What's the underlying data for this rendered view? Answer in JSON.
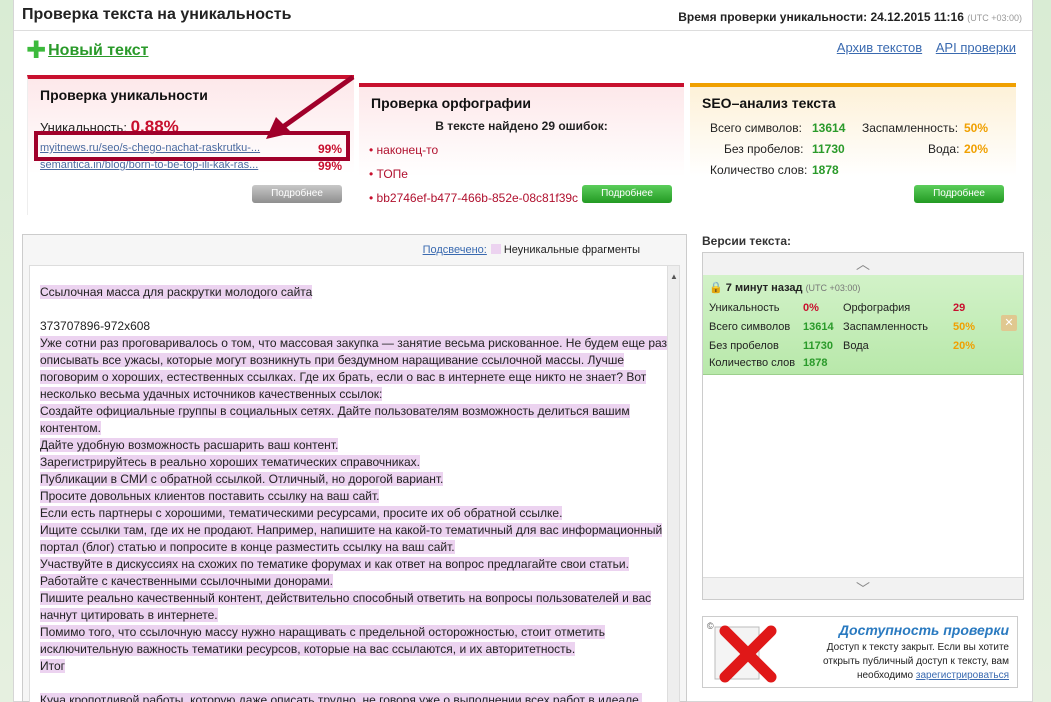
{
  "header": {
    "title": "Проверка текста на уникальность",
    "time_label": "Время проверки уникальности: 24.12.2015 11:16",
    "time_tz": "(UTC +03:00)"
  },
  "new_text": "Новый текст",
  "links": {
    "archive": "Архив текстов",
    "api": "API проверки"
  },
  "uniq_card": {
    "title": "Проверка уникальности",
    "uniq_label": "Уникальность:",
    "uniq_value": "0.88%",
    "sources": [
      {
        "url": "myitnews.ru/seo/s-chego-nachat-raskrutku-...",
        "pct": "99%"
      },
      {
        "url": "semantica.in/blog/born-to-be-top-ili-kak-ras...",
        "pct": "99%"
      }
    ],
    "more": "Подробнее"
  },
  "spell_card": {
    "title": "Проверка орфографии",
    "found": "В тексте найдено 29 ошибок:",
    "errors": [
      "наконец-то",
      "ТОПе",
      "bb2746ef-b477-466b-852e-08c81f39c"
    ],
    "more": "Подробнее"
  },
  "seo_card": {
    "title": "SEO–анализ текста",
    "total_label": "Всего символов:",
    "total": "13614",
    "spam_label": "Заспамленность:",
    "spam": "50%",
    "nospace_label": "Без пробелов:",
    "nospace": "11730",
    "water_label": "Вода:",
    "water": "20%",
    "words_label": "Количество слов:",
    "words": "1878",
    "more": "Подробнее"
  },
  "editor": {
    "highlight_link": "Подсвечено:",
    "legend": "Неуникальные фрагменты",
    "lines": [
      "Ссылочная масса для раскрутки молодого сайта",
      "",
      "373707896-972x608",
      "Уже сотни раз проговаривалось о том, что массовая закупка — занятие весьма рискованное. Не будем еще раз описывать все ужасы, которые могут возникнуть при бездумном наращивание ссылочной массы. Лучше поговорим о хороших, естественных ссылках. Где их брать, если о вас в интернете еще никто не знает? Вот несколько весьма удачных источников качественных ссылок:",
      "Создайте официальные группы в социальных сетях. Дайте пользователям возможность делиться вашим контентом.",
      "Дайте удобную возможность расшарить ваш контент.",
      "Зарегистрируйтесь в реально хороших тематических справочниках.",
      "Публикации в СМИ с обратной ссылкой. Отличный, но дорогой вариант.",
      "Просите довольных клиентов поставить ссылку на ваш сайт.",
      "Если есть партнеры с хорошими, тематическими ресурсами, просите их об обратной ссылке.",
      "Ищите ссылки там, где их не продают. Например, напишите на какой-то тематичный для вас информационный портал (блог) статью и попросите в конце разместить ссылку на ваш сайт.",
      "Участвуйте в дискуссиях на схожих по тематике форумах и как ответ на вопрос предлагайте свои статьи.",
      "Работайте с качественными ссылочными донорами.",
      "Пишите реально качественный контент, действительно способный ответить на вопросы пользователей и вас начнут цитировать в интернете.",
      "Помимо того, что ссылочную массу нужно наращивать с предельной осторожностью, стоит отметить исключительную важность тематики ресурсов, которые на вас ссылаются, и их авторитетность.",
      "Итог",
      "",
      "Куча кропотливой работы, которую даже описать трудно, не говоря уже о выполнении всех работ в идеале,"
    ]
  },
  "versions": {
    "title": "Версии текста:",
    "item": {
      "time": "7 минут назад",
      "tz": "(UTC +03:00)",
      "uniq_label": "Уникальность",
      "uniq": "0%",
      "spell_label": "Орфография",
      "spell": "29",
      "total_label": "Всего символов",
      "total": "13614",
      "spam_label": "Заспамленность",
      "spam": "50%",
      "nospace_label": "Без пробелов",
      "nospace": "11730",
      "water_label": "Вода",
      "water": "20%",
      "words_label": "Количество слов",
      "words": "1878"
    }
  },
  "access": {
    "title": "Доступность проверки",
    "desc": "Доступ к тексту закрыт. Если вы хотите открыть публичный доступ к тексту, вам необходимо",
    "link": "зарегистрироваться",
    "corner": "©"
  },
  "colors": {
    "accent_red": "#c8102e",
    "green": "#2a9a2a",
    "orange": "#f0a000",
    "highlight": "#ecd3f0"
  }
}
